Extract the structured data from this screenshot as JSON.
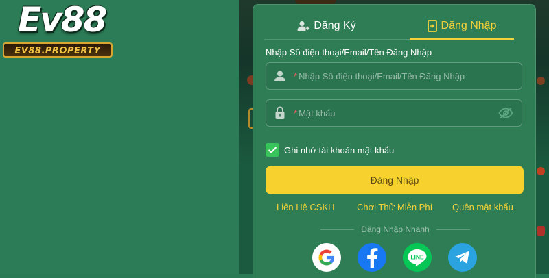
{
  "brand": {
    "logo_text": "Ev88",
    "logo_subtext": "EV88.PROPERTY"
  },
  "tabs": [
    {
      "label": "Đăng Ký",
      "icon": "user-add-icon",
      "active": false
    },
    {
      "label": "Đăng Nhập",
      "icon": "login-door-icon",
      "active": true
    }
  ],
  "form": {
    "username_label": "Nhập Số điện thoại/Email/Tên Đăng Nhập",
    "username_required_mark": "*",
    "username_placeholder": "Nhập Số điện thoại/Email/Tên Đăng Nhập",
    "password_required_mark": "*",
    "password_placeholder": "Mật khẩu",
    "remember_label": "Ghi nhớ tài khoản mật khẩu",
    "remember_checked": true,
    "submit_label": "Đăng Nhập"
  },
  "links": {
    "support": "Liên Hệ CSKH",
    "trial": "Chơi Thử Miễn Phí",
    "forgot": "Quên mật khẩu"
  },
  "quick_login": {
    "label": "Đăng Nhập Nhanh",
    "providers": [
      "google-icon",
      "facebook-icon",
      "line-icon",
      "telegram-icon"
    ]
  },
  "colors": {
    "accent": "#f7d12e",
    "panel": "#2e7d54",
    "background": "#2c7d57"
  }
}
